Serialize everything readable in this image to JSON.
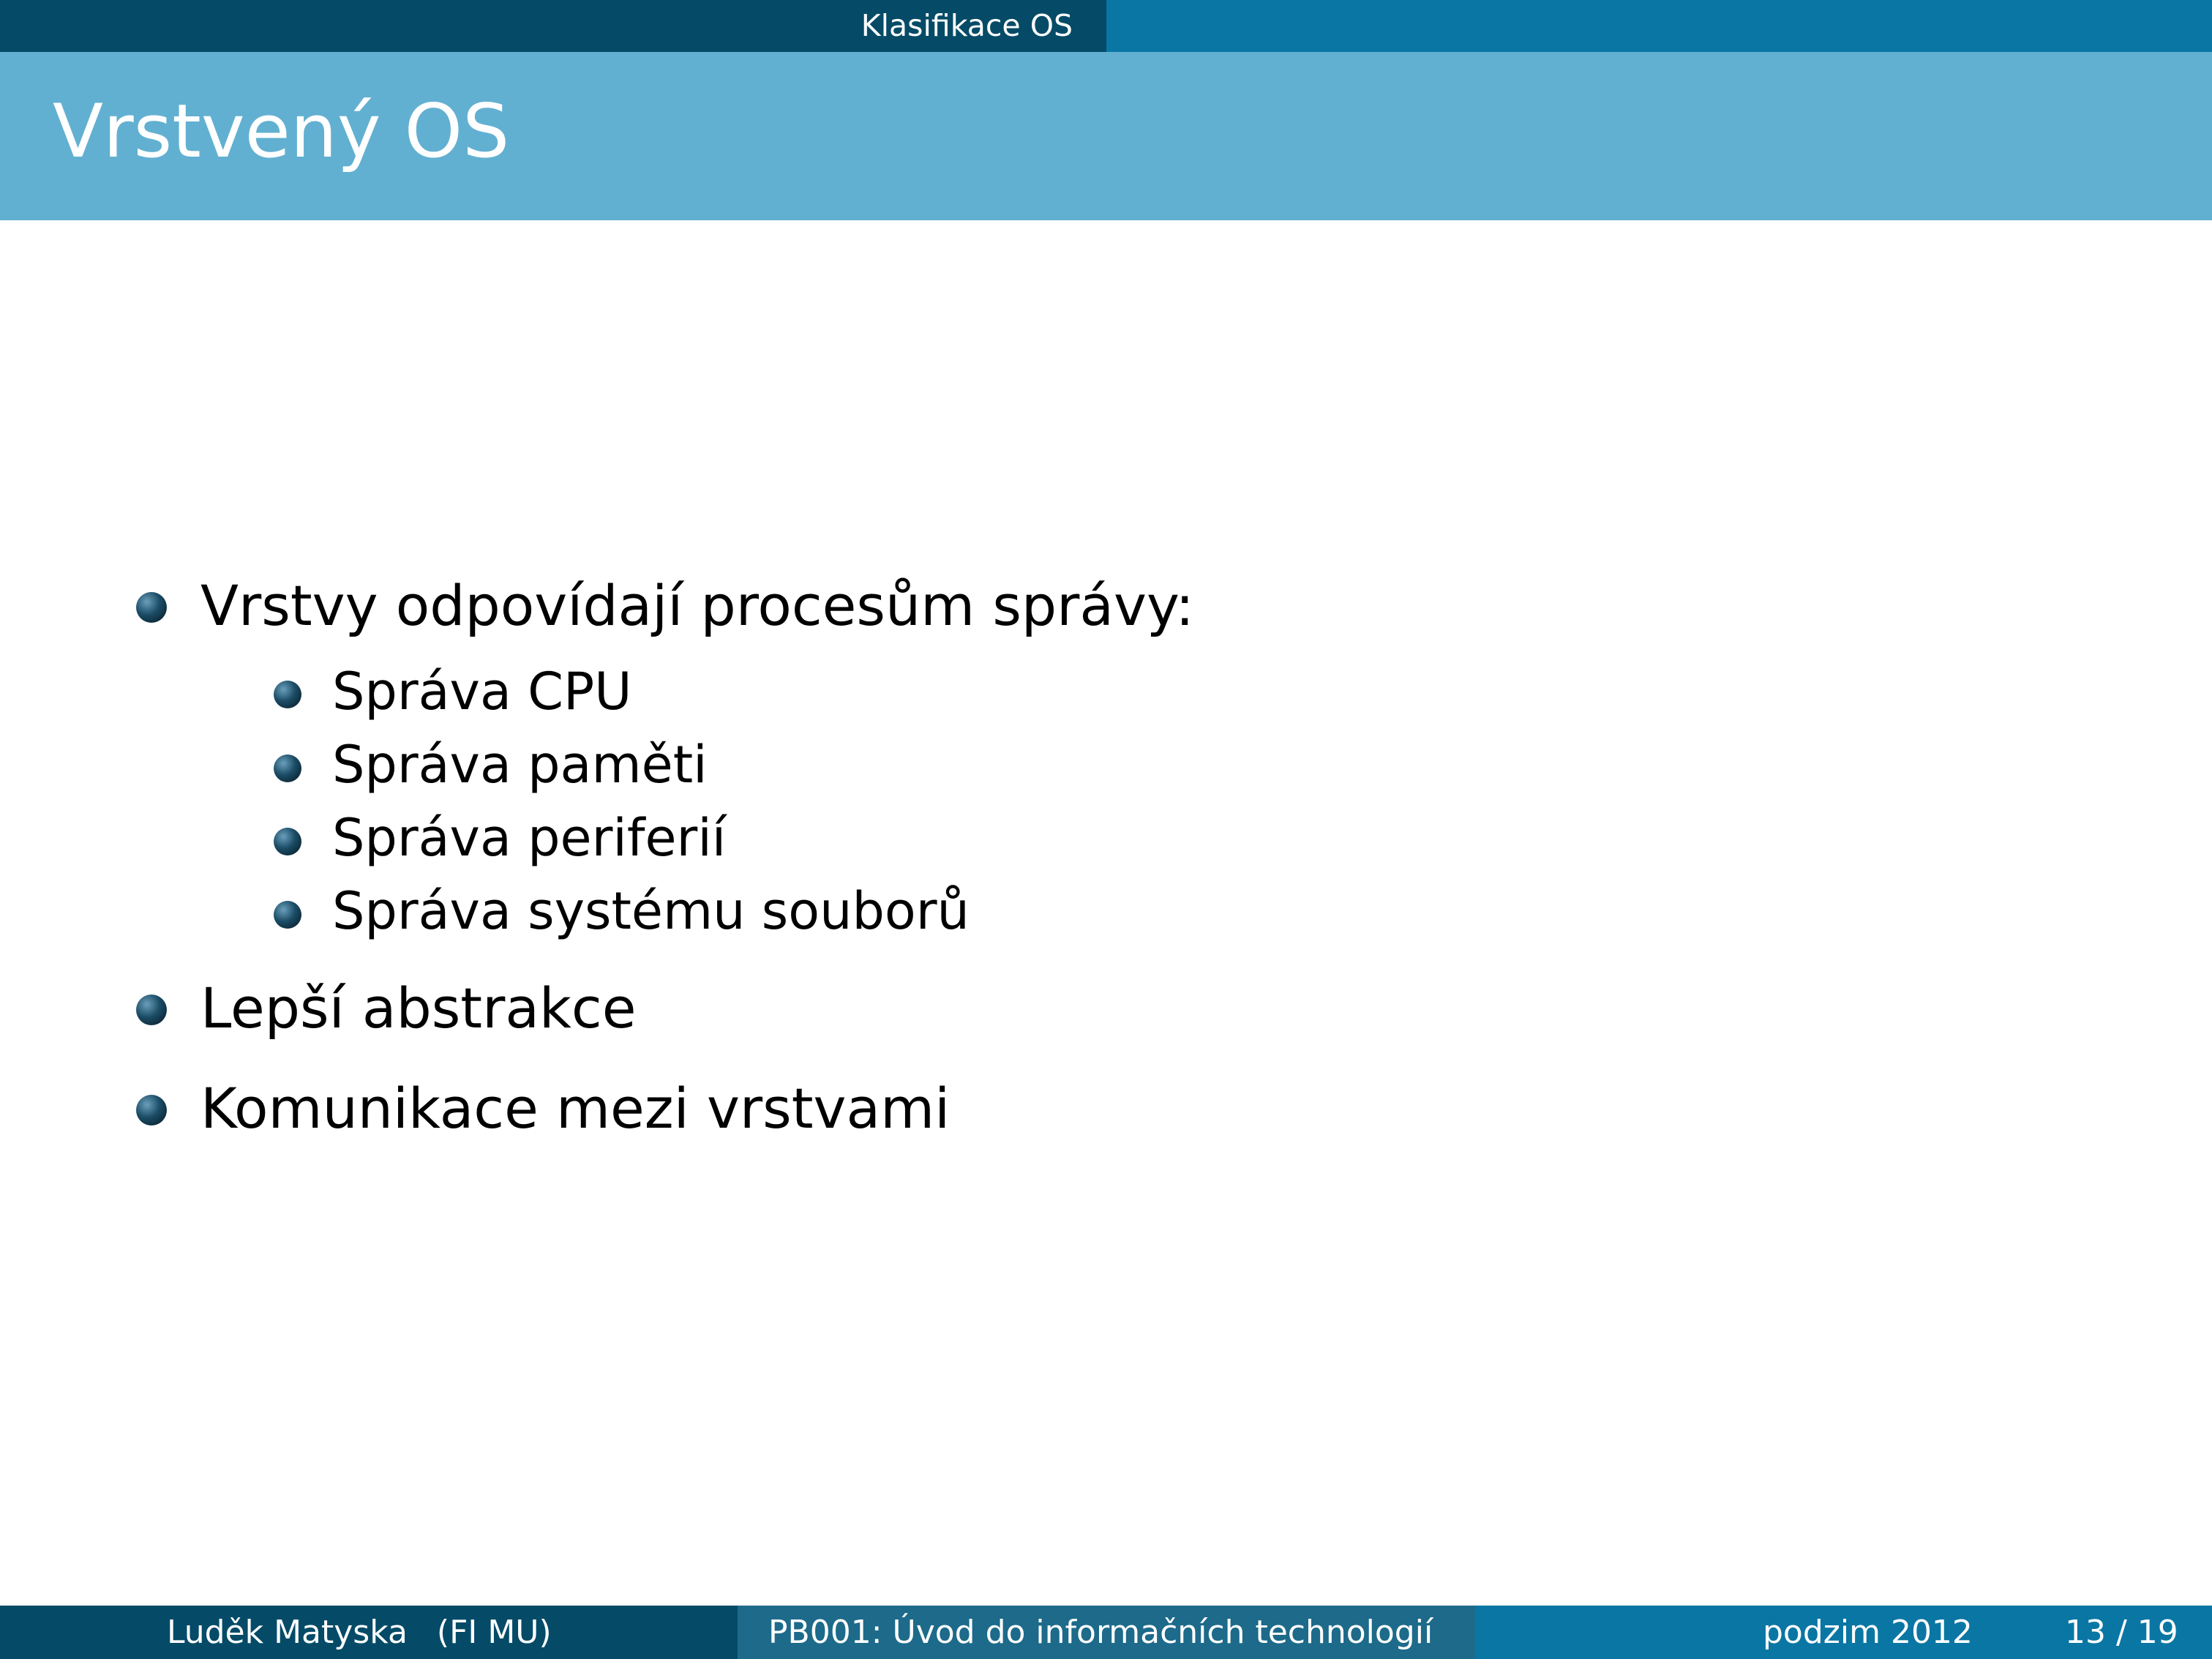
{
  "header": {
    "section": "Klasifikace OS"
  },
  "frame": {
    "title": "Vrstvený OS"
  },
  "content": {
    "items": [
      {
        "text": "Vrstvy odpovídají procesům správy:",
        "subitems": [
          "Správa CPU",
          "Správa paměti",
          "Správa periferií",
          "Správa systému souborů"
        ]
      },
      {
        "text": "Lepší abstrakce"
      },
      {
        "text": "Komunikace mezi vrstvami"
      }
    ]
  },
  "footer": {
    "author": "Luděk Matyska",
    "institute": "(FI MU)",
    "course": "PB001: Úvod do informačních technologií",
    "date": "podzim 2012",
    "page": "13 / 19"
  },
  "colors": {
    "header_dark": "#054b67",
    "header_light": "#0a76a4",
    "title_band": "#62b0d1",
    "footer_mid": "#1d6a8a",
    "bullet": "#1b4c66"
  }
}
